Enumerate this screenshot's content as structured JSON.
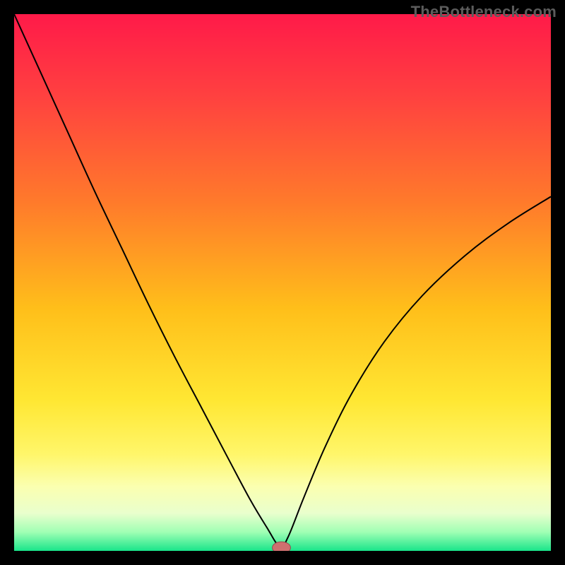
{
  "watermark": "TheBottleneck.com",
  "chart_data": {
    "type": "line",
    "title": "",
    "xlabel": "",
    "ylabel": "",
    "xlim": [
      0,
      100
    ],
    "ylim": [
      0,
      100
    ],
    "grid": false,
    "legend": false,
    "background_gradient": {
      "stops": [
        {
          "offset": 0.0,
          "color": "#ff1a49"
        },
        {
          "offset": 0.15,
          "color": "#ff4040"
        },
        {
          "offset": 0.35,
          "color": "#ff7a2b"
        },
        {
          "offset": 0.55,
          "color": "#ffbf1a"
        },
        {
          "offset": 0.72,
          "color": "#ffe733"
        },
        {
          "offset": 0.82,
          "color": "#fff66a"
        },
        {
          "offset": 0.88,
          "color": "#fbffb0"
        },
        {
          "offset": 0.93,
          "color": "#e9ffcd"
        },
        {
          "offset": 0.965,
          "color": "#a0ffb4"
        },
        {
          "offset": 1.0,
          "color": "#19e58a"
        }
      ]
    },
    "series": [
      {
        "name": "bottleneck-curve",
        "x": [
          0,
          5,
          10,
          15,
          20,
          25,
          30,
          35,
          40,
          44,
          47,
          49.5,
          51,
          54,
          58,
          63,
          69,
          76,
          84,
          92,
          100
        ],
        "values": [
          100,
          89,
          78,
          67,
          56.5,
          46,
          36,
          26.5,
          17,
          9.5,
          4.5,
          0.8,
          2.5,
          10,
          19.5,
          29.5,
          39,
          47.5,
          55,
          61,
          66
        ],
        "color": "#000000",
        "line_width": 2
      }
    ],
    "marker": {
      "x": 49.8,
      "y": 0.6,
      "rx": 1.7,
      "ry": 1.1,
      "fill": "#cf6f6f",
      "stroke": "#8d4a4a"
    }
  }
}
